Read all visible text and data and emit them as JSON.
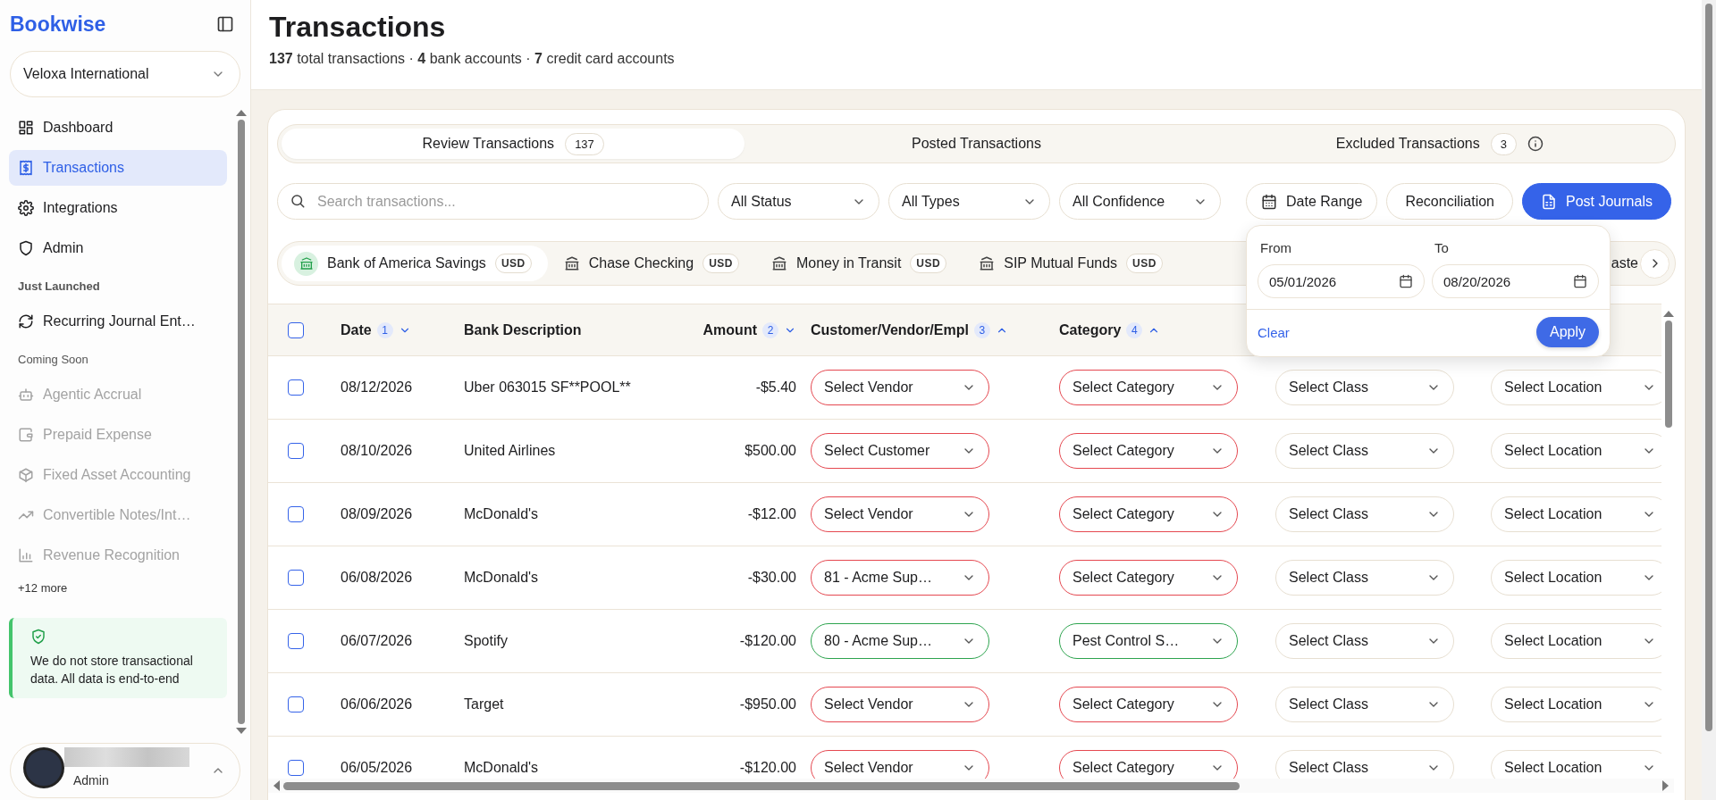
{
  "sidebar": {
    "logo": "Bookwise",
    "organization": "Veloxa International",
    "nav": [
      {
        "label": "Dashboard",
        "selected": false
      },
      {
        "label": "Transactions",
        "selected": true
      },
      {
        "label": "Integrations",
        "selected": false
      },
      {
        "label": "Admin",
        "selected": false
      }
    ],
    "sections": [
      {
        "title": "Just Launched",
        "kind": "launched",
        "items": [
          {
            "label": "Recurring Journal Ent…",
            "disabled": false
          }
        ]
      },
      {
        "title": "Coming Soon",
        "kind": "soon",
        "items": [
          {
            "label": "Agentic Accrual",
            "disabled": true
          },
          {
            "label": "Prepaid Expense",
            "disabled": true
          },
          {
            "label": "Fixed Asset Accounting",
            "disabled": true
          },
          {
            "label": "Convertible Notes/Int…",
            "disabled": true
          },
          {
            "label": "Revenue Recognition",
            "disabled": true
          }
        ]
      }
    ],
    "more": "+12 more",
    "notice": "We do not store transactional data. All data is end-to-end",
    "user": {
      "role": "Admin"
    }
  },
  "header": {
    "title": "Transactions",
    "subtitle": "**137** total transactions · **4** bank accounts · **7** credit card accounts"
  },
  "tabs": [
    {
      "label": "Review Transactions",
      "count": "137",
      "selected": true
    },
    {
      "label": "Posted Transactions",
      "selected": false
    },
    {
      "label": "Excluded Transactions",
      "count": "3",
      "selected": false
    }
  ],
  "filters": {
    "search": {
      "placeholder": "Search transactions..."
    },
    "selects": [
      "All Status",
      "All Types",
      "All Confidence"
    ],
    "date_range": "Date Range",
    "reconciliation": "Reconciliation",
    "post": "Post Journals"
  },
  "date_popup": {
    "from_label": "From",
    "from": "05/01/2026",
    "to_label": "To",
    "to": "08/20/2026",
    "clear": "Clear",
    "apply": "Apply"
  },
  "accounts": [
    {
      "name": "Bank of America Savings",
      "currency": "USD",
      "selected": true
    },
    {
      "name": "Chase Checking",
      "currency": "USD",
      "selected": false
    },
    {
      "name": "Money in Transit",
      "currency": "USD",
      "selected": false
    },
    {
      "name": "SIP Mutual Funds",
      "currency": "USD",
      "selected": false
    },
    {
      "name": "aste",
      "selected": false
    }
  ],
  "table": {
    "all_checked": false,
    "columns": [
      {
        "label": "Date",
        "sort_order": "1",
        "ascending": false
      },
      {
        "label": "Bank Description"
      },
      {
        "label": "Amount",
        "sort_order": "2",
        "ascending": false
      },
      {
        "label": "Customer/Vendor/Empl",
        "sort_order": "3",
        "ascending": true
      },
      {
        "label": "Category",
        "sort_order": "4",
        "ascending": true
      }
    ],
    "rows": [
      {
        "checked": false,
        "date": "08/12/2026",
        "description": "Uber 063015 SF**POOL**",
        "amount": "-$5.40",
        "party": {
          "text": "Select Vendor",
          "kind": "missing"
        },
        "category": {
          "text": "Select Category",
          "kind": "missing"
        },
        "class": {
          "text": "Select Class"
        },
        "location": {
          "text": "Select Location"
        }
      },
      {
        "checked": false,
        "date": "08/10/2026",
        "description": "United Airlines",
        "amount": "$500.00",
        "party": {
          "text": "Select Customer",
          "kind": "missing"
        },
        "category": {
          "text": "Select Category",
          "kind": "missing"
        },
        "class": {
          "text": "Select Class"
        },
        "location": {
          "text": "Select Location"
        }
      },
      {
        "checked": false,
        "date": "08/09/2026",
        "description": "McDonald's",
        "amount": "-$12.00",
        "party": {
          "text": "Select Vendor",
          "kind": "missing"
        },
        "category": {
          "text": "Select Category",
          "kind": "missing"
        },
        "class": {
          "text": "Select Class"
        },
        "location": {
          "text": "Select Location"
        }
      },
      {
        "checked": false,
        "date": "06/08/2026",
        "description": "McDonald's",
        "amount": "-$30.00",
        "party": {
          "text": "81 - Acme Sup…",
          "kind": "missing"
        },
        "category": {
          "text": "Select Category",
          "kind": "missing"
        },
        "class": {
          "text": "Select Class"
        },
        "location": {
          "text": "Select Location"
        }
      },
      {
        "checked": false,
        "date": "06/07/2026",
        "description": "Spotify",
        "amount": "-$120.00",
        "party": {
          "text": "80 - Acme Sup…",
          "kind": "matched"
        },
        "category": {
          "text": "Pest Control S…",
          "kind": "matched"
        },
        "class": {
          "text": "Select Class"
        },
        "location": {
          "text": "Select Location"
        }
      },
      {
        "checked": false,
        "date": "06/06/2026",
        "description": "Target",
        "amount": "-$950.00",
        "party": {
          "text": "Select Vendor",
          "kind": "missing"
        },
        "category": {
          "text": "Select Category",
          "kind": "missing"
        },
        "class": {
          "text": "Select Class"
        },
        "location": {
          "text": "Select Location"
        }
      },
      {
        "checked": false,
        "date": "06/05/2026",
        "description": "McDonald's",
        "amount": "-$120.00",
        "party": {
          "text": "Select Vendor",
          "kind": "missing"
        },
        "category": {
          "text": "Select Category",
          "kind": "missing"
        },
        "class": {
          "text": "Select Class"
        },
        "location": {
          "text": "Select Location"
        }
      }
    ]
  }
}
